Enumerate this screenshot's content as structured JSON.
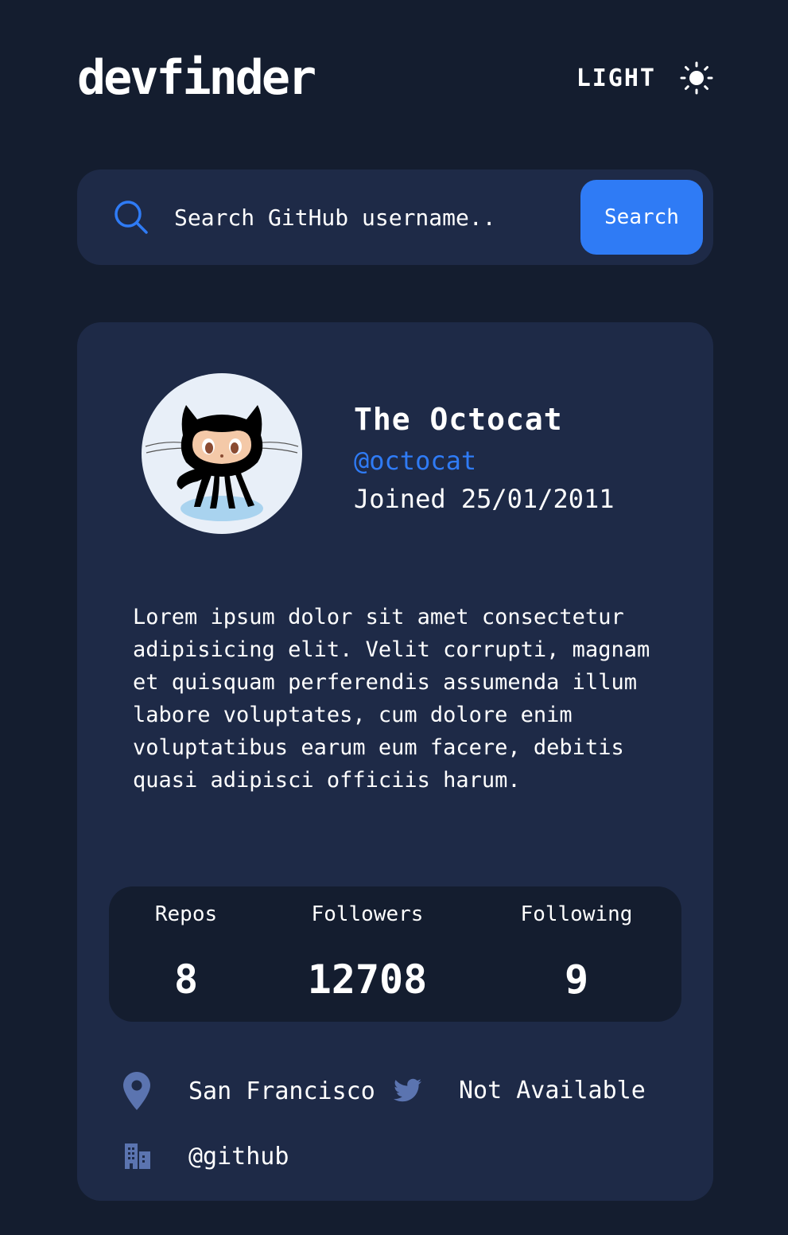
{
  "header": {
    "logo": "devfinder",
    "theme_label": "LIGHT",
    "theme_icon": "sun-icon"
  },
  "search": {
    "placeholder": "Search GitHub username..",
    "value": "",
    "button_label": "Search",
    "icon": "search-icon"
  },
  "profile": {
    "name": "The Octocat",
    "login": "@octocat",
    "joined": "Joined 25/01/2011",
    "bio": "Lorem ipsum dolor sit amet consectetur adipisicing elit. Velit corrupti, magnam et quisquam perferendis assumenda illum labore voluptates, cum dolore enim voluptatibus earum eum facere, debitis quasi adipisci officiis harum."
  },
  "stats": {
    "repos_label": "Repos",
    "repos_value": "8",
    "followers_label": "Followers",
    "followers_value": "12708",
    "following_label": "Following",
    "following_value": "9"
  },
  "links": {
    "location": "San Francisco",
    "twitter": "Not Available",
    "company": "@github"
  },
  "colors": {
    "background": "#141d2f",
    "card": "#1e2a47",
    "accent": "#2f7bf5",
    "icon_muted": "#5b74b0",
    "text": "#ffffff"
  }
}
